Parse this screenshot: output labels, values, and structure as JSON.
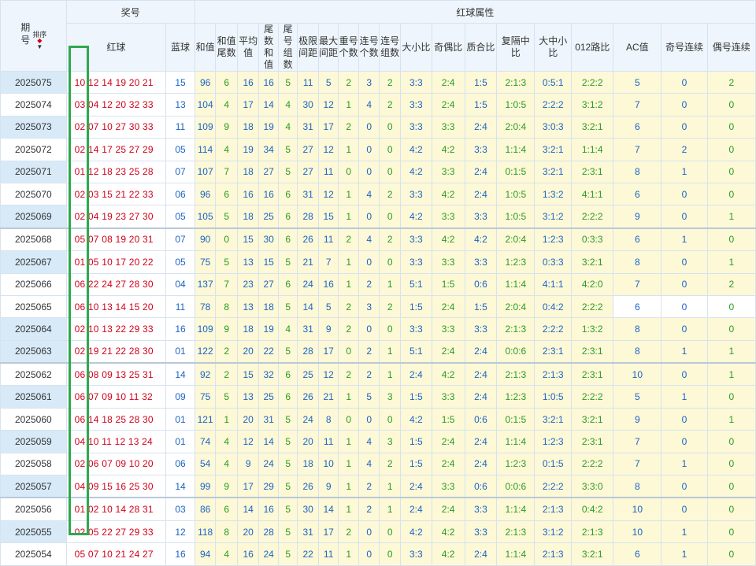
{
  "header": {
    "issue_label": "期号",
    "sort_label": "排序",
    "prize_label": "奖号",
    "red_ball_attr_label": "红球属性",
    "red_label": "红球",
    "blue_label": "蓝球",
    "cols": [
      "和值",
      "和值尾数",
      "平均值",
      "尾数和值",
      "尾号组数",
      "极限间距",
      "最大间距",
      "重号个数",
      "连号个数",
      "连号组数",
      "大小比",
      "奇偶比",
      "质合比",
      "复隔中比",
      "大中小比",
      "012路比",
      "AC值",
      "奇号连续",
      "偶号连续"
    ]
  },
  "colors": {
    "red": "#d0021b",
    "blue": "#1a64c8",
    "green": "#2a9b25",
    "highlight": "#2fa84f",
    "row_blue": "#d8eaf8",
    "attr_bg": "#fdf8d6"
  },
  "rows": [
    {
      "issue": "2025075",
      "red": "10 12 14 19 20 21",
      "blue": "15",
      "vals": [
        "96",
        "6",
        "16",
        "16",
        "5",
        "11",
        "5",
        "2",
        "3",
        "2",
        "3:3",
        "2:4",
        "1:5",
        "2:1:3",
        "0:5:1",
        "2:2:2",
        "5",
        "0",
        "2"
      ]
    },
    {
      "issue": "2025074",
      "red": "03 04 12 20 32 33",
      "blue": "13",
      "vals": [
        "104",
        "4",
        "17",
        "14",
        "4",
        "30",
        "12",
        "1",
        "4",
        "2",
        "3:3",
        "2:4",
        "1:5",
        "1:0:5",
        "2:2:2",
        "3:1:2",
        "7",
        "0",
        "0"
      ]
    },
    {
      "issue": "2025073",
      "red": "02 07 10 27 30 33",
      "blue": "11",
      "vals": [
        "109",
        "9",
        "18",
        "19",
        "4",
        "31",
        "17",
        "2",
        "0",
        "0",
        "3:3",
        "3:3",
        "2:4",
        "2:0:4",
        "3:0:3",
        "3:2:1",
        "6",
        "0",
        "0"
      ]
    },
    {
      "issue": "2025072",
      "red": "02 14 17 25 27 29",
      "blue": "05",
      "vals": [
        "114",
        "4",
        "19",
        "34",
        "5",
        "27",
        "12",
        "1",
        "0",
        "0",
        "4:2",
        "4:2",
        "3:3",
        "1:1:4",
        "3:2:1",
        "1:1:4",
        "7",
        "2",
        "0"
      ]
    },
    {
      "issue": "2025071",
      "red": "01 12 18 23 25 28",
      "blue": "07",
      "vals": [
        "107",
        "7",
        "18",
        "27",
        "5",
        "27",
        "11",
        "0",
        "0",
        "0",
        "4:2",
        "3:3",
        "2:4",
        "0:1:5",
        "3:2:1",
        "2:3:1",
        "8",
        "1",
        "0"
      ]
    },
    {
      "issue": "2025070",
      "red": "02 03 15 21 22 33",
      "blue": "06",
      "vals": [
        "96",
        "6",
        "16",
        "16",
        "6",
        "31",
        "12",
        "1",
        "4",
        "2",
        "3:3",
        "4:2",
        "2:4",
        "1:0:5",
        "1:3:2",
        "4:1:1",
        "6",
        "0",
        "0"
      ]
    },
    {
      "issue": "2025069",
      "red": "02 04 19 23 27 30",
      "blue": "05",
      "vals": [
        "105",
        "5",
        "18",
        "25",
        "6",
        "28",
        "15",
        "1",
        "0",
        "0",
        "4:2",
        "3:3",
        "3:3",
        "1:0:5",
        "3:1:2",
        "2:2:2",
        "9",
        "0",
        "1"
      ]
    },
    {
      "issue": "2025068",
      "red": "05 07 08 19 20 31",
      "blue": "07",
      "vals": [
        "90",
        "0",
        "15",
        "30",
        "6",
        "26",
        "11",
        "2",
        "4",
        "2",
        "3:3",
        "4:2",
        "4:2",
        "2:0:4",
        "1:2:3",
        "0:3:3",
        "6",
        "1",
        "0"
      ]
    },
    {
      "issue": "2025067",
      "red": "01 05 10 17 20 22",
      "blue": "05",
      "vals": [
        "75",
        "5",
        "13",
        "15",
        "5",
        "21",
        "7",
        "1",
        "0",
        "0",
        "3:3",
        "3:3",
        "3:3",
        "1:2:3",
        "0:3:3",
        "3:2:1",
        "8",
        "0",
        "1"
      ]
    },
    {
      "issue": "2025066",
      "red": "06 22 24 27 28 30",
      "blue": "04",
      "vals": [
        "137",
        "7",
        "23",
        "27",
        "6",
        "24",
        "16",
        "1",
        "2",
        "1",
        "5:1",
        "1:5",
        "0:6",
        "1:1:4",
        "4:1:1",
        "4:2:0",
        "7",
        "0",
        "2"
      ]
    },
    {
      "issue": "2025065",
      "red": "06 10 13 14 15 20",
      "blue": "11",
      "vals": [
        "78",
        "8",
        "13",
        "18",
        "5",
        "14",
        "5",
        "2",
        "3",
        "2",
        "1:5",
        "2:4",
        "1:5",
        "2:0:4",
        "0:4:2",
        "2:2:2",
        "6",
        "0",
        "0"
      ]
    },
    {
      "issue": "2025064",
      "red": "02 10 13 22 29 33",
      "blue": "16",
      "vals": [
        "109",
        "9",
        "18",
        "19",
        "4",
        "31",
        "9",
        "2",
        "0",
        "0",
        "3:3",
        "3:3",
        "3:3",
        "2:1:3",
        "2:2:2",
        "1:3:2",
        "8",
        "0",
        "0"
      ]
    },
    {
      "issue": "2025063",
      "red": "02 19 21 22 28 30",
      "blue": "01",
      "vals": [
        "122",
        "2",
        "20",
        "22",
        "5",
        "28",
        "17",
        "0",
        "2",
        "1",
        "5:1",
        "2:4",
        "2:4",
        "0:0:6",
        "2:3:1",
        "2:3:1",
        "8",
        "1",
        "1"
      ]
    },
    {
      "issue": "2025062",
      "red": "06 08 09 13 25 31",
      "blue": "14",
      "vals": [
        "92",
        "2",
        "15",
        "32",
        "6",
        "25",
        "12",
        "2",
        "2",
        "1",
        "2:4",
        "4:2",
        "2:4",
        "2:1:3",
        "2:1:3",
        "2:3:1",
        "10",
        "0",
        "1"
      ]
    },
    {
      "issue": "2025061",
      "red": "06 07 09 10 11 32",
      "blue": "09",
      "vals": [
        "75",
        "5",
        "13",
        "25",
        "6",
        "26",
        "21",
        "1",
        "5",
        "3",
        "1:5",
        "3:3",
        "2:4",
        "1:2:3",
        "1:0:5",
        "2:2:2",
        "5",
        "1",
        "0"
      ]
    },
    {
      "issue": "2025060",
      "red": "06 14 18 25 28 30",
      "blue": "01",
      "vals": [
        "121",
        "1",
        "20",
        "31",
        "5",
        "24",
        "8",
        "0",
        "0",
        "0",
        "4:2",
        "1:5",
        "0:6",
        "0:1:5",
        "3:2:1",
        "3:2:1",
        "9",
        "0",
        "1"
      ]
    },
    {
      "issue": "2025059",
      "red": "04 10 11 12 13 24",
      "blue": "01",
      "vals": [
        "74",
        "4",
        "12",
        "14",
        "5",
        "20",
        "11",
        "1",
        "4",
        "3",
        "1:5",
        "2:4",
        "2:4",
        "1:1:4",
        "1:2:3",
        "2:3:1",
        "7",
        "0",
        "0"
      ]
    },
    {
      "issue": "2025058",
      "red": "02 06 07 09 10 20",
      "blue": "06",
      "vals": [
        "54",
        "4",
        "9",
        "24",
        "5",
        "18",
        "10",
        "1",
        "4",
        "2",
        "1:5",
        "2:4",
        "2:4",
        "1:2:3",
        "0:1:5",
        "2:2:2",
        "7",
        "1",
        "0"
      ]
    },
    {
      "issue": "2025057",
      "red": "04 09 15 16 25 30",
      "blue": "14",
      "vals": [
        "99",
        "9",
        "17",
        "29",
        "5",
        "26",
        "9",
        "1",
        "2",
        "1",
        "2:4",
        "3:3",
        "0:6",
        "0:0:6",
        "2:2:2",
        "3:3:0",
        "8",
        "0",
        "0"
      ]
    },
    {
      "issue": "2025056",
      "red": "01 02 10 14 28 31",
      "blue": "03",
      "vals": [
        "86",
        "6",
        "14",
        "16",
        "5",
        "30",
        "14",
        "1",
        "2",
        "1",
        "2:4",
        "2:4",
        "3:3",
        "1:1:4",
        "2:1:3",
        "0:4:2",
        "10",
        "0",
        "0"
      ]
    },
    {
      "issue": "2025055",
      "red": "02 05 22 27 29 33",
      "blue": "12",
      "vals": [
        "118",
        "8",
        "20",
        "28",
        "5",
        "31",
        "17",
        "2",
        "0",
        "0",
        "4:2",
        "4:2",
        "3:3",
        "2:1:3",
        "3:1:2",
        "2:1:3",
        "10",
        "1",
        "0"
      ]
    },
    {
      "issue": "2025054",
      "red": "05 07 10 21 24 27",
      "blue": "16",
      "vals": [
        "94",
        "4",
        "16",
        "24",
        "5",
        "22",
        "11",
        "1",
        "0",
        "0",
        "3:3",
        "4:2",
        "2:4",
        "1:1:4",
        "2:1:3",
        "3:2:1",
        "6",
        "1",
        "0"
      ]
    }
  ]
}
